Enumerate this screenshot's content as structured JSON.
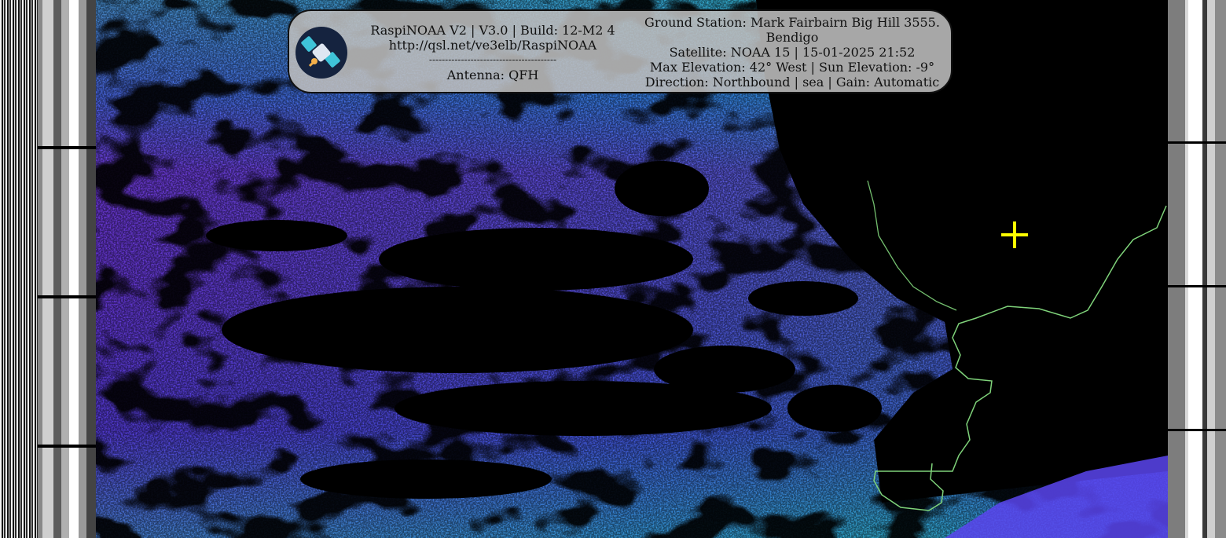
{
  "overlay": {
    "line1": "RaspiNOAA V2 | V3.0 | Build: 12-M2 4",
    "line2": "http://qsl.net/ve3elb/RaspiNOAA",
    "line3": "----------------------------------------",
    "line4": "Antenna: QFH",
    "station_line1": "Ground Station: Mark Fairbairn Big Hill 3555.",
    "station_line2": "Bendigo",
    "satellite_line": "Satellite: NOAA 15 | 15-01-2025 21:52",
    "elevation_line": "Max Elevation: 42° West | Sun Elevation: -9°",
    "direction_line": "Direction: Northbound | sea | Gain: Automatic"
  },
  "icons": {
    "logo": "satellite-logo-icon",
    "marker": "crosshair-icon"
  },
  "colors": {
    "overlay_bg": "#bebebe",
    "coastline": "#7fd37a",
    "marker": "#ffff00",
    "noise_purple": "#7b3ff2",
    "noise_cyan": "#39d6e6",
    "noise_blue": "#2d5bff"
  }
}
